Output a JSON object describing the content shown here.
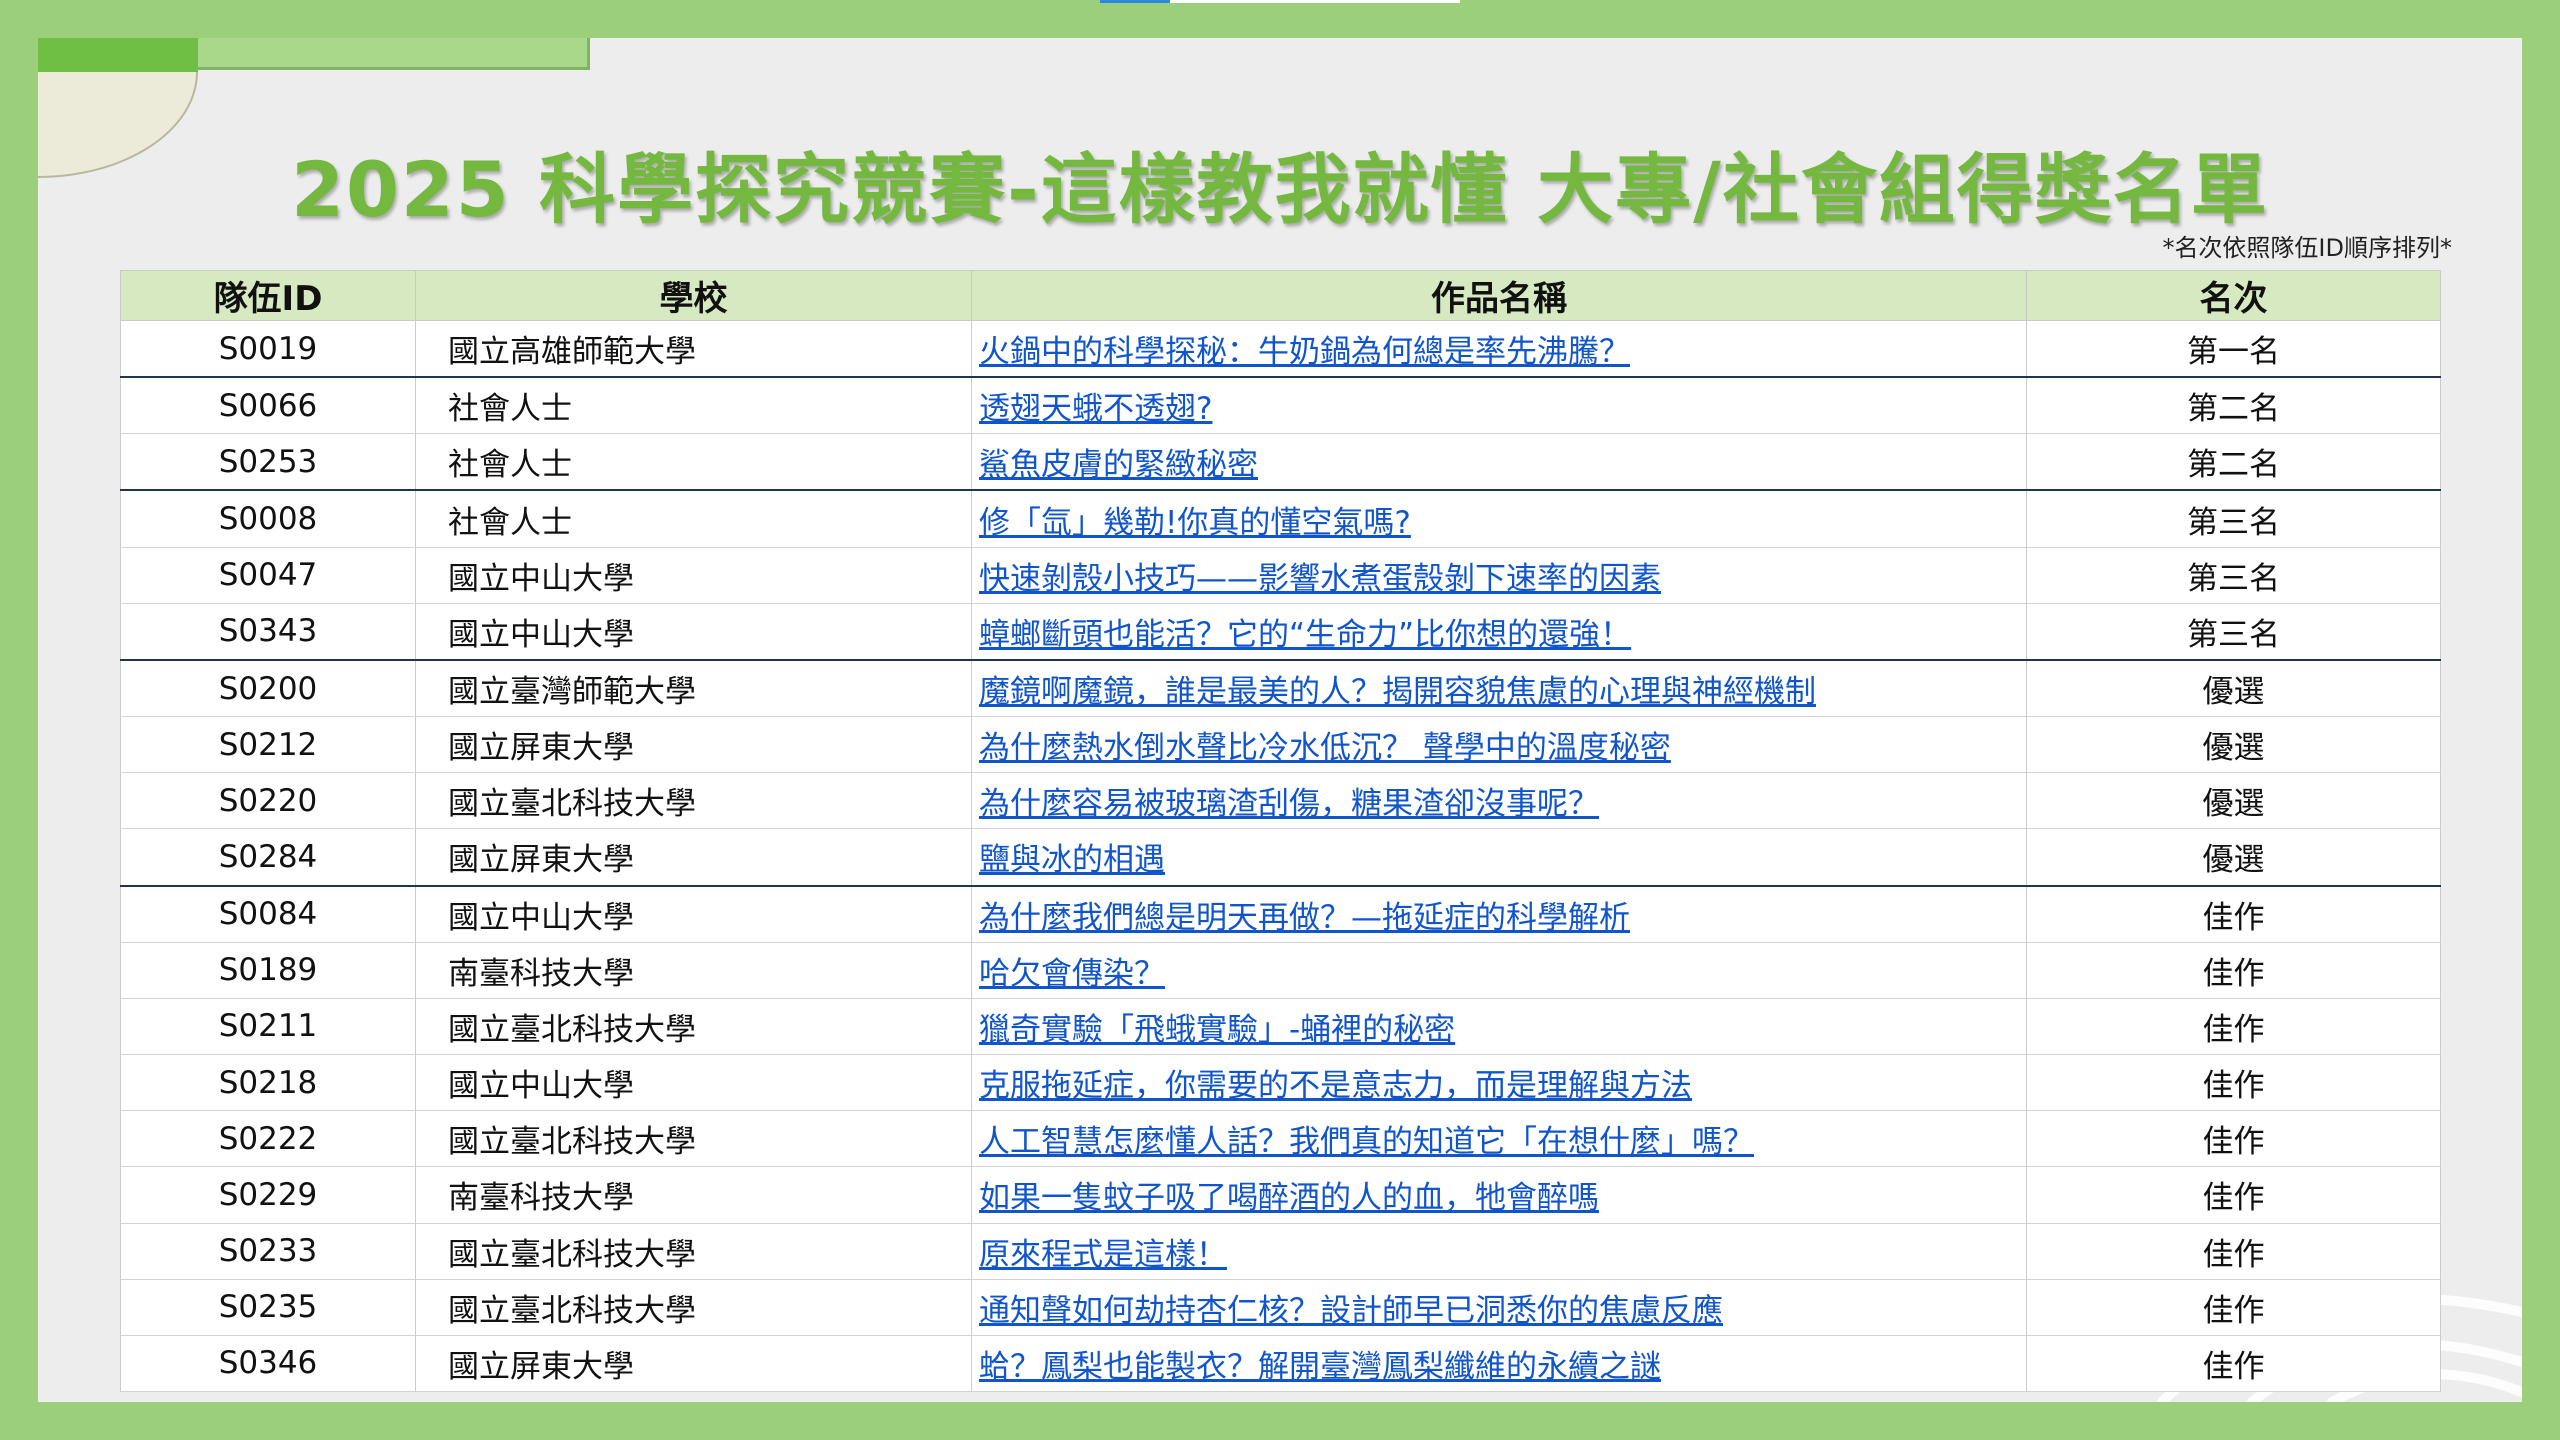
{
  "title": "2025 科學探究競賽-這樣教我就懂 大專/社會組得獎名單",
  "note": "*名次依照隊伍ID順序排列*",
  "colors": {
    "frame": "#9ccf7c",
    "title": "#74b840",
    "header_bg": "#d6e9c1",
    "link": "#1155cc"
  },
  "table": {
    "headers": {
      "team_id": "隊伍ID",
      "school": "學校",
      "work": "作品名稱",
      "rank": "名次"
    },
    "rows": [
      {
        "id": "S0019",
        "school": "國立高雄師範大學",
        "work": "火鍋中的科學探秘：牛奶鍋為何總是率先沸騰？",
        "rank": "第一名"
      },
      {
        "id": "S0066",
        "school": "社會人士",
        "work": "透翅天蛾不透翅?",
        "rank": "第二名"
      },
      {
        "id": "S0253",
        "school": "社會人士",
        "work": "鯊魚皮膚的緊緻秘密",
        "rank": "第二名"
      },
      {
        "id": "S0008",
        "school": "社會人士",
        "work": "修「氙」幾勒!你真的懂空氣嗎?",
        "rank": "第三名"
      },
      {
        "id": "S0047",
        "school": "國立中山大學",
        "work": "快速剝殼小技巧——影響水煮蛋殼剝下速率的因素",
        "rank": "第三名"
      },
      {
        "id": "S0343",
        "school": "國立中山大學",
        "work": "蟑螂斷頭也能活？它的“生命力”比你想的還強！",
        "rank": "第三名"
      },
      {
        "id": "S0200",
        "school": "國立臺灣師範大學",
        "work": "魔鏡啊魔鏡，誰是最美的人？揭開容貌焦慮的心理與神經機制",
        "rank": "優選"
      },
      {
        "id": "S0212",
        "school": "國立屏東大學",
        "work": "為什麼熱水倒水聲比冷水低沉？ 聲學中的溫度秘密",
        "rank": "優選"
      },
      {
        "id": "S0220",
        "school": "國立臺北科技大學",
        "work": "為什麼容易被玻璃渣刮傷，糖果渣卻沒事呢？",
        "rank": "優選"
      },
      {
        "id": "S0284",
        "school": "國立屏東大學",
        "work": "鹽與冰的相遇",
        "rank": "優選"
      },
      {
        "id": "S0084",
        "school": "國立中山大學",
        "work": "為什麼我們總是明天再做？—拖延症的科學解析",
        "rank": "佳作"
      },
      {
        "id": "S0189",
        "school": "南臺科技大學",
        "work": "哈欠會傳染？",
        "rank": "佳作"
      },
      {
        "id": "S0211",
        "school": "國立臺北科技大學",
        "work": "獵奇實驗「飛蛾實驗」-蛹裡的秘密",
        "rank": "佳作"
      },
      {
        "id": "S0218",
        "school": "國立中山大學",
        "work": "克服拖延症，你需要的不是意志力，而是理解與方法",
        "rank": "佳作"
      },
      {
        "id": "S0222",
        "school": "國立臺北科技大學",
        "work": "人工智慧怎麼懂人話？我們真的知道它「在想什麼」嗎？",
        "rank": "佳作"
      },
      {
        "id": "S0229",
        "school": "南臺科技大學",
        "work": "如果一隻蚊子吸了喝醉酒的人的血，牠會醉嗎",
        "rank": "佳作"
      },
      {
        "id": "S0233",
        "school": "國立臺北科技大學",
        "work": "原來程式是這樣！",
        "rank": "佳作"
      },
      {
        "id": "S0235",
        "school": "國立臺北科技大學",
        "work": "通知聲如何劫持杏仁核？設計師早已洞悉你的焦慮反應",
        "rank": "佳作"
      },
      {
        "id": "S0346",
        "school": "國立屏東大學",
        "work": "蛤？鳳梨也能製衣？解開臺灣鳳梨纖維的永續之謎",
        "rank": "佳作"
      }
    ]
  }
}
